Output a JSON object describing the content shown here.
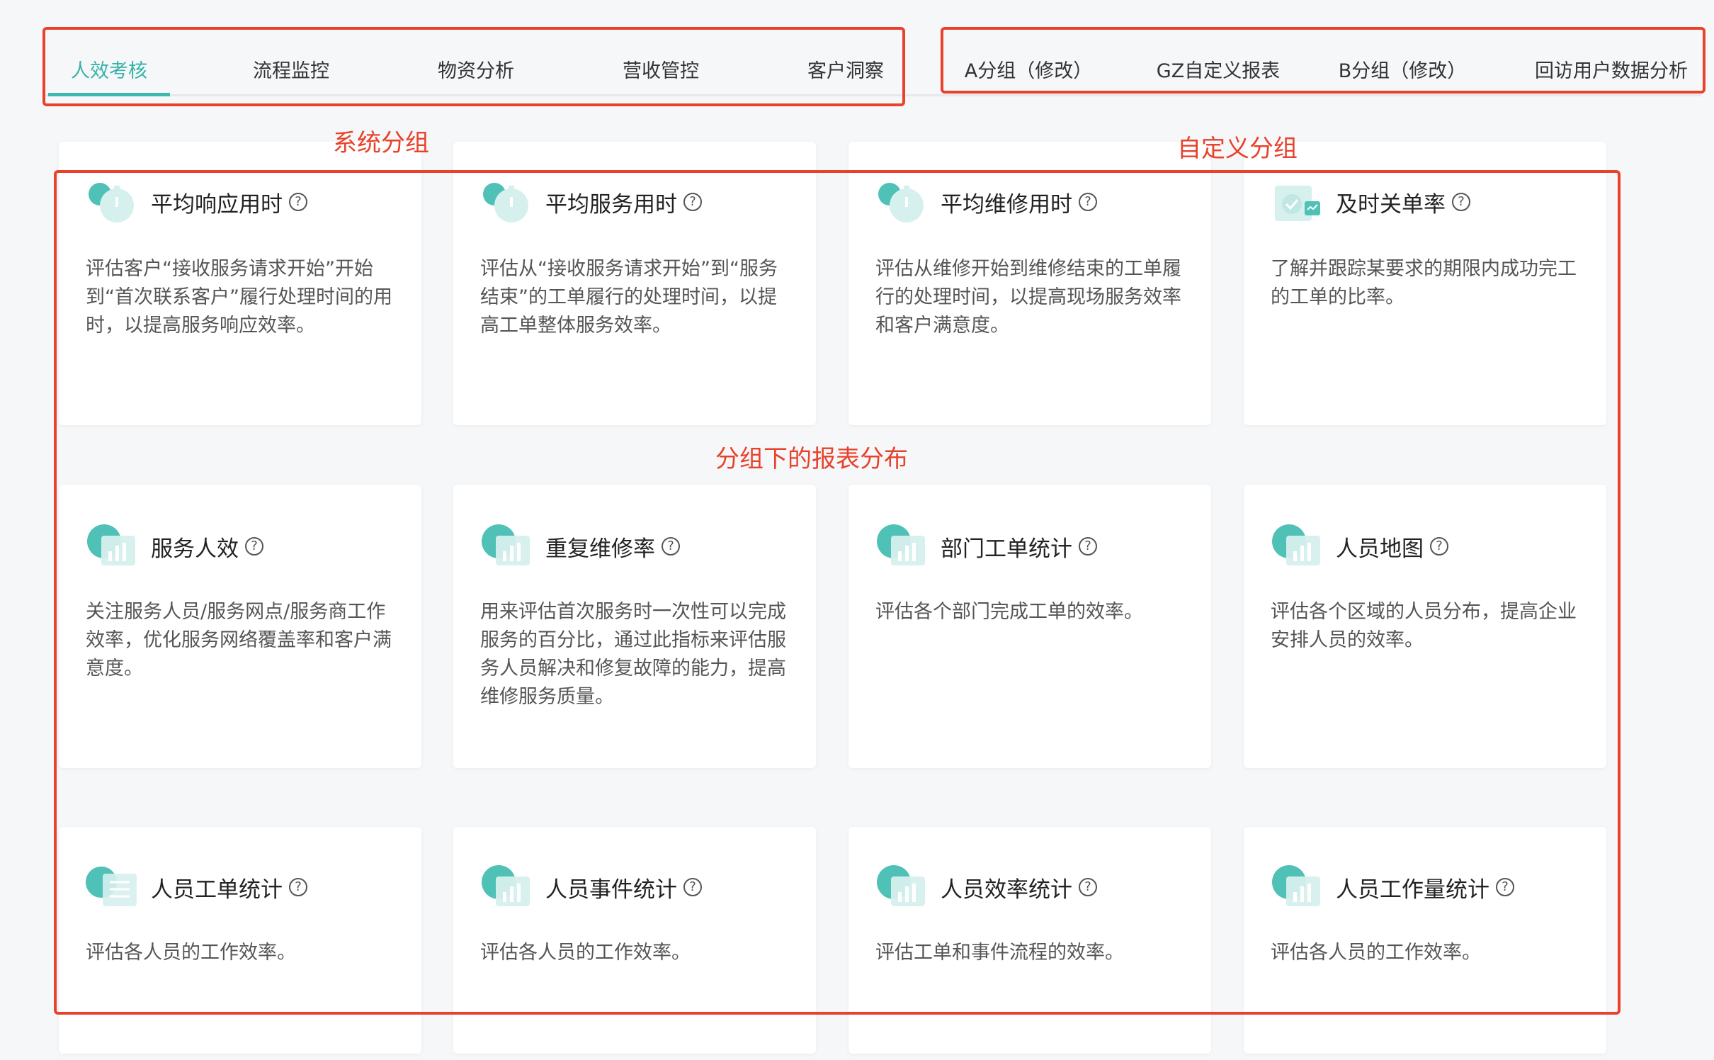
{
  "system_tabs": [
    "人效考核",
    "流程监控",
    "物资分析",
    "营收管控",
    "客户洞察"
  ],
  "custom_tabs": [
    "A分组（修改）",
    "GZ自定义报表",
    "B分组（修改）",
    "回访用户数据分析"
  ],
  "annotations": {
    "system_group": "系统分组",
    "custom_group": "自定义分组",
    "reports": "分组下的报表分布"
  },
  "cards": [
    {
      "title": "平均响应用时",
      "desc": "评估客户“接收服务请求开始”开始到“首次联系客户”履行处理时间的用时，以提高服务响应效率。",
      "icon": "clock-person-icon"
    },
    {
      "title": "平均服务用时",
      "desc": "评估从“接收服务请求开始”到“服务结束”的工单履行的处理时间，以提高工单整体服务效率。",
      "icon": "clock-worker-icon"
    },
    {
      "title": "平均维修用时",
      "desc": "评估从维修开始到维修结束的工单履行的处理时间，以提高现场服务效率和客户满意度。",
      "icon": "clock-wrench-icon"
    },
    {
      "title": "及时关单率",
      "desc": "了解并跟踪某要求的期限内成功完工的工单的比率。",
      "icon": "clipboard-check-icon"
    },
    {
      "title": "服务人效",
      "desc": "关注服务人员/服务网点/服务商工作效率，优化服务网络覆盖率和客户满意度。",
      "icon": "person-chart-icon"
    },
    {
      "title": "重复维修率",
      "desc": "用来评估首次服务时一次性可以完成服务的百分比，通过此指标来评估服务人员解决和修复故障的能力，提高维修服务质量。",
      "icon": "repeat-chart-icon"
    },
    {
      "title": "部门工单统计",
      "desc": "评估各个部门完成工单的效率。",
      "icon": "bar-chart-icon"
    },
    {
      "title": "人员地图",
      "desc": "评估各个区域的人员分布，提高企业安排人员的效率。",
      "icon": "map-person-icon"
    },
    {
      "title": "人员工单统计",
      "desc": "评估各人员的工作效率。",
      "icon": "list-icon"
    },
    {
      "title": "人员事件统计",
      "desc": "评估各人员的工作效率。",
      "icon": "bar-chart-icon"
    },
    {
      "title": "人员效率统计",
      "desc": "评估工单和事件流程的效率。",
      "icon": "bar-chart-icon"
    },
    {
      "title": "人员工作量统计",
      "desc": "评估各人员的工作效率。",
      "icon": "bar-chart-icon"
    }
  ],
  "help_glyph": "?",
  "colors": {
    "accent": "#3fb8ad",
    "annotation": "#e8422c",
    "icon_teal": "#4fc1b6"
  }
}
